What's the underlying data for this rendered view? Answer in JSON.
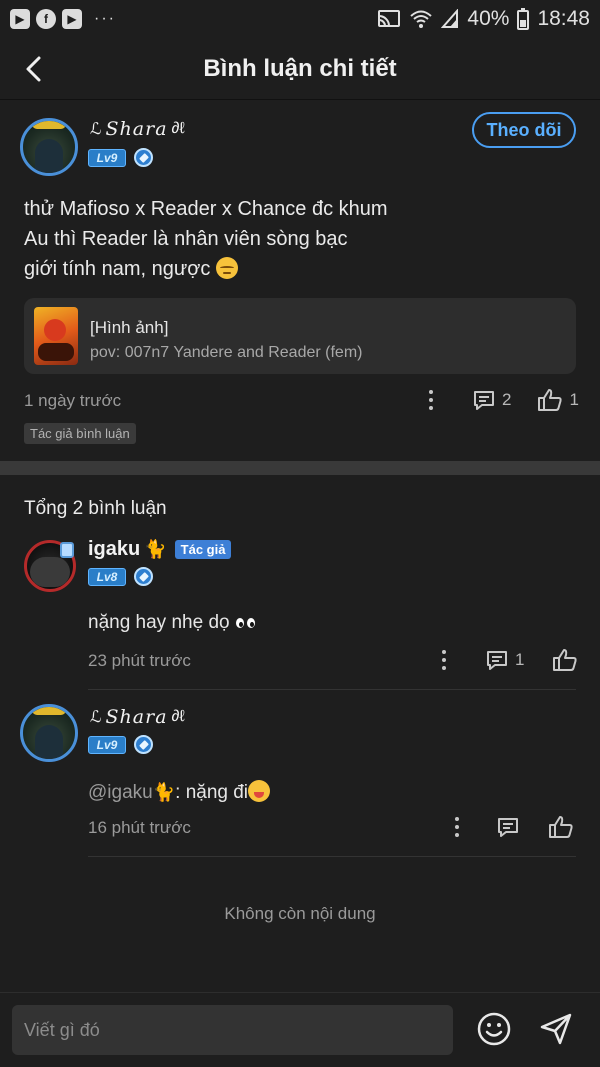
{
  "status_bar": {
    "apps": [
      "tv-app-icon",
      "facebook-icon",
      "youtube-icon"
    ],
    "dots": "···",
    "battery": "40%",
    "time": "18:48"
  },
  "header": {
    "title": "Bình luận chi tiết"
  },
  "post": {
    "author": {
      "name": "Shara",
      "level": "Lv9"
    },
    "follow_label": "Theo dõi",
    "lines": [
      "thử Mafioso x Reader x Chance đc khum",
      "Au thì Reader là nhân viên sòng bạc",
      "giới tính nam, ngược"
    ],
    "attachment": {
      "title": "[Hình ảnh]",
      "subtitle": "pov: 007n7 Yandere and Reader (fem)"
    },
    "time": "1 ngày trước",
    "comment_count": "2",
    "like_count": "1",
    "author_tag": "Tác giả bình luận"
  },
  "comments_section": {
    "total_label": "Tổng 2 bình luận"
  },
  "comments": [
    {
      "name": "igaku",
      "author_tag": "Tác giả",
      "level": "Lv8",
      "text": "nặng hay nhẹ dọ",
      "time": "23 phút trước",
      "reply_count": "1"
    },
    {
      "name": "Shara",
      "level": "Lv9",
      "mention": "@igaku",
      "text": ": nặng đi",
      "time": "16 phút trước"
    }
  ],
  "end_label": "Không còn nội dung",
  "composer": {
    "placeholder": "Viết gì đó"
  },
  "colors": {
    "accent": "#4a9ef2",
    "background": "#1e1e1e",
    "level_badge": "#2a7ec8"
  }
}
